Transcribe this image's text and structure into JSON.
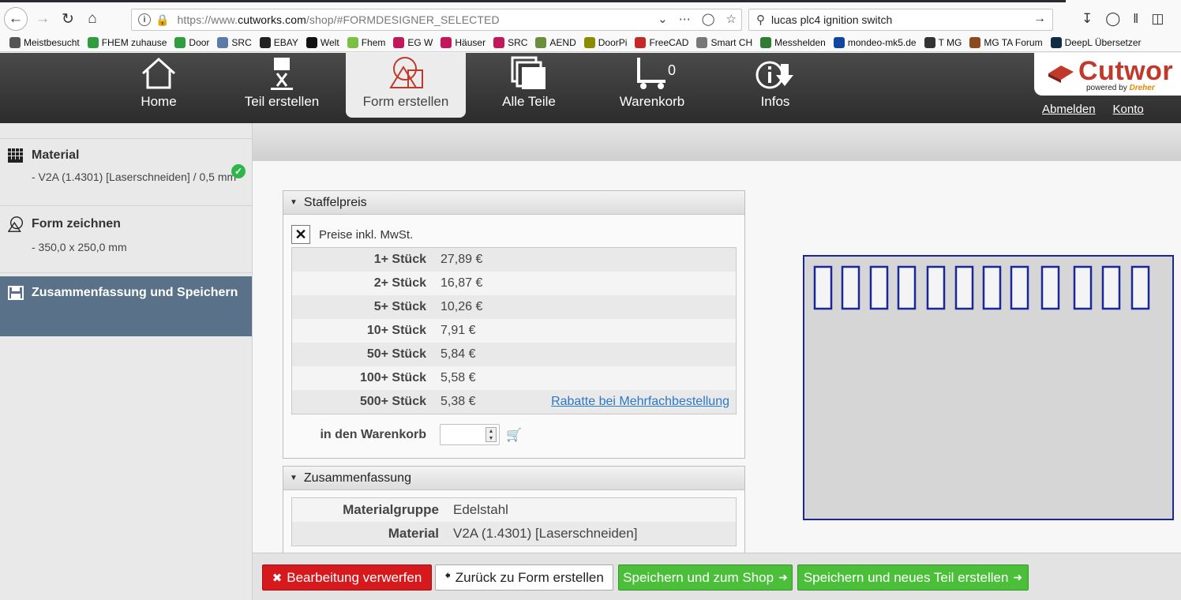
{
  "browser": {
    "url_prefix": "https://www.",
    "url_domain": "cutworks.com",
    "url_path": "/shop/#FORMDESIGNER_SELECTED",
    "search_query": "lucas plc4 ignition switch",
    "bookmarks": [
      {
        "label": "Meistbesucht",
        "icon": "gear-icon",
        "color": "#555555"
      },
      {
        "label": "FHEM zuhause",
        "icon": "spinner-icon",
        "color": "#2e9e3e"
      },
      {
        "label": "Door",
        "icon": "spinner-icon",
        "color": "#2e9e3e"
      },
      {
        "label": "SRC",
        "icon": "image-icon",
        "color": "#5b7ba8"
      },
      {
        "label": "EBAY",
        "icon": "briefcase-icon",
        "color": "#222222"
      },
      {
        "label": "Welt",
        "icon": "w-icon",
        "color": "#111111"
      },
      {
        "label": "Fhem",
        "icon": "house-icon",
        "color": "#7bc043"
      },
      {
        "label": "EG W",
        "icon": "k-icon",
        "color": "#c2185b"
      },
      {
        "label": "Häuser",
        "icon": "k-icon",
        "color": "#c2185b"
      },
      {
        "label": "SRC",
        "icon": "k-icon",
        "color": "#c2185b"
      },
      {
        "label": "AEND",
        "icon": "doc-icon",
        "color": "#6a8f3c"
      },
      {
        "label": "DoorPi",
        "icon": "raspberry-icon",
        "color": "#8b8b00"
      },
      {
        "label": "FreeCAD",
        "icon": "freecad-icon",
        "color": "#c62828"
      },
      {
        "label": "Smart CH",
        "icon": "globe-icon",
        "color": "#777777"
      },
      {
        "label": "Messhelden",
        "icon": "check-icon",
        "color": "#2e7d32"
      },
      {
        "label": "mondeo-mk5.de",
        "icon": "ford-icon",
        "color": "#0d47a1"
      },
      {
        "label": "T MG",
        "icon": "mg-icon",
        "color": "#333333"
      },
      {
        "label": "MG TA Forum",
        "icon": "mg-badge-icon",
        "color": "#8d4a1e"
      },
      {
        "label": "DeepL Übersetzer",
        "icon": "deepl-icon",
        "color": "#0f2b46"
      }
    ]
  },
  "nav": {
    "home": "Home",
    "teil": "Teil erstellen",
    "form": "Form erstellen",
    "alle": "Alle Teile",
    "warenkorb": "Warenkorb",
    "cart_count": "0",
    "infos": "Infos"
  },
  "logo": {
    "word": "Cutwor",
    "powered_by": "powered by",
    "brand": "Dreher"
  },
  "account": {
    "abmelden": "Abmelden",
    "konto": "Konto"
  },
  "sidebar": {
    "material_title": "Material",
    "material_sub": "- V2A (1.4301) [Laserschneiden] / 0,5 mm",
    "form_title": "Form zeichnen",
    "form_sub": "- 350,0 x 250,0 mm",
    "summary_title": "Zusammenfassung und Speichern"
  },
  "staffelpreis": {
    "title": "Staffelpreis",
    "mwst_label": "Preise inkl. MwSt.",
    "rows": [
      {
        "qty": "1+ Stück",
        "price": "27,89 €"
      },
      {
        "qty": "2+ Stück",
        "price": "16,87 €"
      },
      {
        "qty": "5+ Stück",
        "price": "10,26 €"
      },
      {
        "qty": "10+ Stück",
        "price": "7,91 €"
      },
      {
        "qty": "50+ Stück",
        "price": "5,84 €"
      },
      {
        "qty": "100+ Stück",
        "price": "5,58 €"
      },
      {
        "qty": "500+ Stück",
        "price": "5,38 €"
      }
    ],
    "rabatt_link": "Rabatte bei Mehrfachbestellung",
    "cart_label": "in den Warenkorb"
  },
  "zusammenfassung": {
    "title": "Zusammenfassung",
    "rows": [
      {
        "key": "Materialgruppe",
        "value": "Edelstahl"
      },
      {
        "key": "Material",
        "value": "V2A (1.4301) [Laserschneiden]"
      }
    ]
  },
  "buttons": {
    "discard": "Bearbeitung verwerfen",
    "back": "Zurück zu Form erstellen",
    "save_shop": "Speichern und zum Shop",
    "save_new": "Speichern und neues Teil erstellen"
  },
  "colors": {
    "accent_blue": "#1a2799",
    "sidebar_active": "#5a7289",
    "danger": "#d5191c",
    "success": "#4bbf3a"
  }
}
